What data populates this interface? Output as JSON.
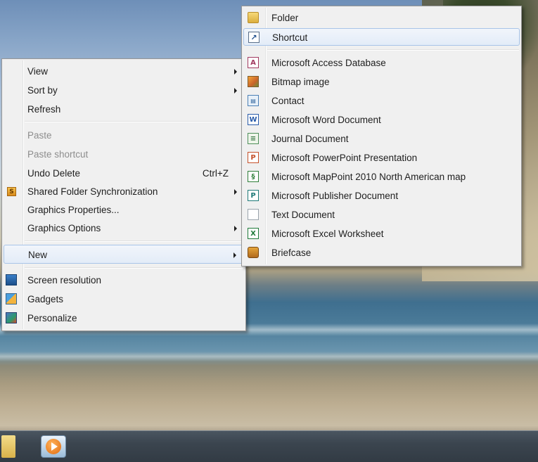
{
  "context_menu": {
    "items": [
      {
        "label": "View",
        "submenu": true
      },
      {
        "label": "Sort by",
        "submenu": true
      },
      {
        "label": "Refresh"
      },
      {
        "label": "Paste",
        "disabled": true
      },
      {
        "label": "Paste shortcut",
        "disabled": true
      },
      {
        "label": "Undo Delete",
        "shortcut": "Ctrl+Z"
      },
      {
        "label": "Shared Folder Synchronization",
        "submenu": true,
        "icon": "shared-folder-sync-icon"
      },
      {
        "label": "Graphics Properties..."
      },
      {
        "label": "Graphics Options",
        "submenu": true
      },
      {
        "label": "New",
        "submenu": true,
        "highlighted": true
      },
      {
        "label": "Screen resolution",
        "icon": "screen-resolution-icon"
      },
      {
        "label": "Gadgets",
        "icon": "gadgets-icon"
      },
      {
        "label": "Personalize",
        "icon": "personalize-icon"
      }
    ],
    "shared_icon_text": "S"
  },
  "new_submenu": {
    "items": [
      {
        "label": "Folder",
        "icon": "folder-icon"
      },
      {
        "label": "Shortcut",
        "icon": "shortcut-icon",
        "highlighted": true,
        "glyph": "↗"
      },
      {
        "label": "Microsoft Access Database",
        "icon": "access-database-icon",
        "glyph": "A"
      },
      {
        "label": "Bitmap image",
        "icon": "bitmap-image-icon"
      },
      {
        "label": "Contact",
        "icon": "contact-icon",
        "glyph": "▤"
      },
      {
        "label": "Microsoft Word Document",
        "icon": "word-document-icon",
        "glyph": "W"
      },
      {
        "label": "Journal Document",
        "icon": "journal-document-icon",
        "glyph": "≡"
      },
      {
        "label": "Microsoft PowerPoint Presentation",
        "icon": "powerpoint-icon",
        "glyph": "P"
      },
      {
        "label": "Microsoft MapPoint 2010 North American map",
        "icon": "mappoint-icon",
        "glyph": "§"
      },
      {
        "label": "Microsoft Publisher Document",
        "icon": "publisher-icon",
        "glyph": "P"
      },
      {
        "label": "Text Document",
        "icon": "text-document-icon"
      },
      {
        "label": "Microsoft Excel Worksheet",
        "icon": "excel-worksheet-icon",
        "glyph": "X"
      },
      {
        "label": "Briefcase",
        "icon": "briefcase-icon"
      }
    ]
  },
  "taskbar": {
    "pinned": [
      {
        "name": "windows-explorer-icon"
      },
      {
        "name": "media-player-icon"
      }
    ]
  },
  "colors": {
    "menu_background": "#f0f0f0",
    "highlight_border": "#a8c4e8",
    "disabled_text": "#8d8d8d"
  }
}
